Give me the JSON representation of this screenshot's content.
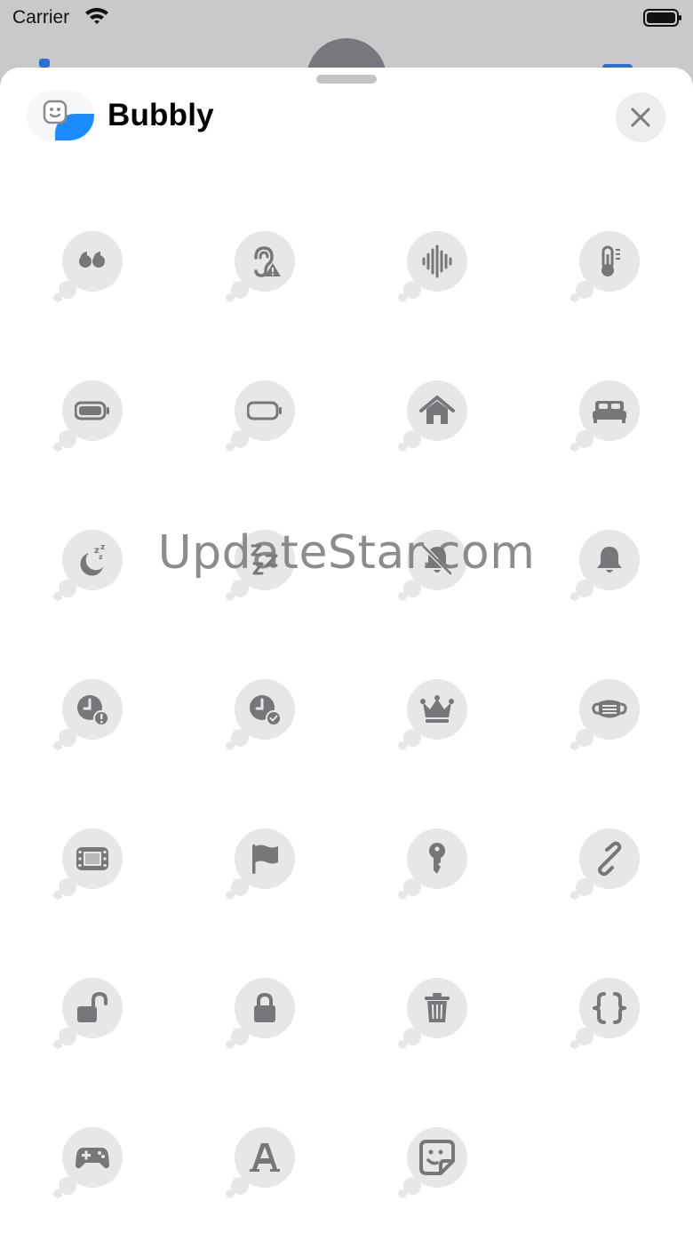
{
  "status_bar": {
    "carrier": "Carrier"
  },
  "header": {
    "title": "Bubbly",
    "close_icon": "xmark-icon"
  },
  "watermark": "UpdateStar.com",
  "colors": {
    "accent": "#1a8cff",
    "bubble": "#e7e7ea",
    "glyph": "#77777b"
  },
  "stickers": [
    "quote-icon",
    "ear-warning-icon",
    "waveform-icon",
    "thermometer-icon",
    "battery-full-icon",
    "battery-empty-icon",
    "house-icon",
    "bed-icon",
    "moon-zzz-icon",
    "zzz-icon",
    "bell-slash-icon",
    "bell-icon",
    "clock-exclamation-icon",
    "clock-check-icon",
    "crown-icon",
    "face-mask-icon",
    "film-icon",
    "flag-icon",
    "key-icon",
    "link-icon",
    "lock-open-icon",
    "lock-icon",
    "trash-icon",
    "curly-braces-icon",
    "gamecontroller-icon",
    "textformat-icon",
    "face-sticker-icon"
  ]
}
